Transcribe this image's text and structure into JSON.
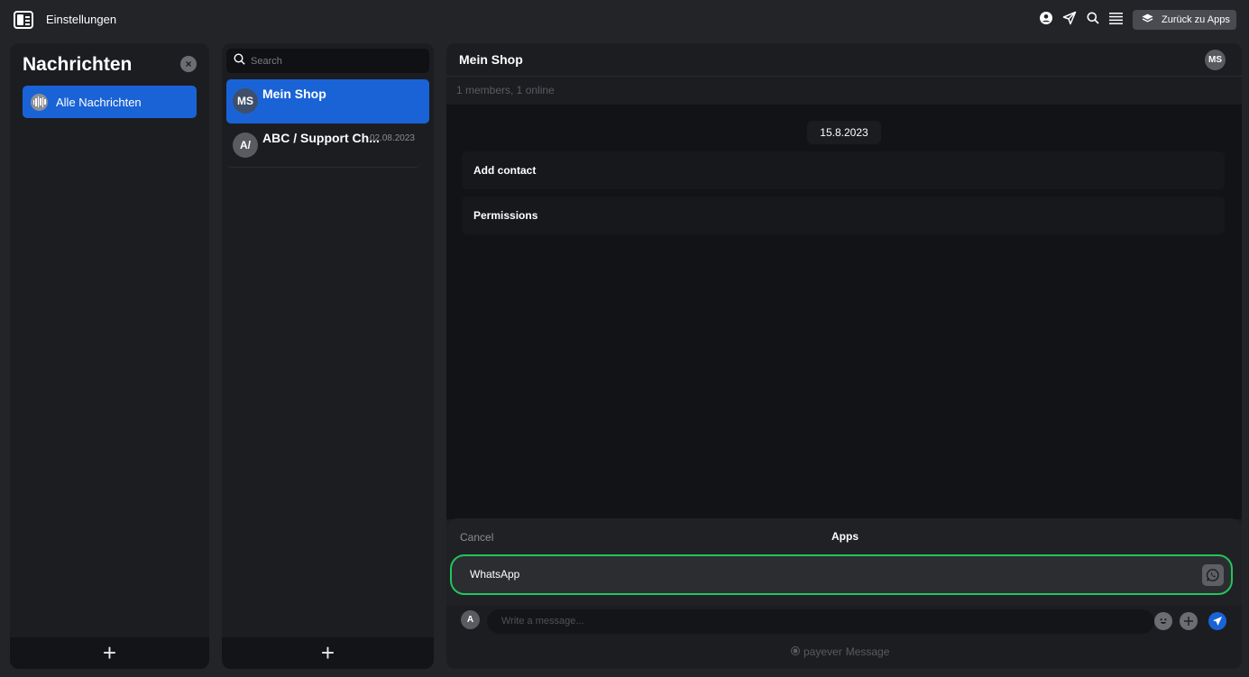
{
  "topbar": {
    "title": "Einstellungen",
    "back_label": "Zurück zu Apps",
    "icons": [
      "sidebar-toggle-icon",
      "user-icon",
      "send-icon",
      "search-icon",
      "menu-icon",
      "layers-icon"
    ]
  },
  "sidebar": {
    "title": "Nachrichten",
    "items": [
      {
        "label": "Alle Nachrichten",
        "icon": "audio-wave-icon",
        "active": true
      }
    ],
    "add_label": "+"
  },
  "conversations": {
    "search_placeholder": "Search",
    "items": [
      {
        "initials": "MS",
        "name": "Mein Shop",
        "date": "",
        "active": true
      },
      {
        "initials": "A/",
        "name": "ABC / Support Ch...",
        "date": "02.08.2023",
        "active": false
      }
    ],
    "add_label": "+"
  },
  "chat": {
    "title": "Mein Shop",
    "avatar": "MS",
    "subtitle": "1 members, 1 online",
    "date_chip": "15.8.2023",
    "actions": [
      "Add contact",
      "Permissions"
    ]
  },
  "apps_sheet": {
    "cancel_label": "Cancel",
    "title": "Apps",
    "items": [
      {
        "label": "WhatsApp",
        "icon": "whatsapp-icon",
        "selected": true
      }
    ]
  },
  "composer": {
    "avatar": "A",
    "placeholder": "Write a message...",
    "brand": "payever",
    "brand_suffix": "Message"
  },
  "colors": {
    "accent": "#1a63d6",
    "selected_border": "#22c55e",
    "background": "#232428",
    "panel": "#1c1d21"
  }
}
